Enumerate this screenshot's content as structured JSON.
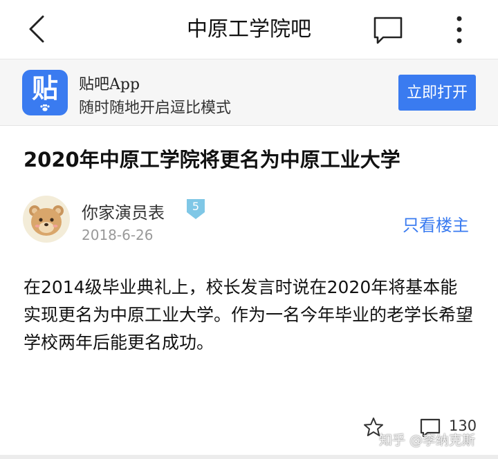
{
  "header": {
    "title": "中原工学院吧"
  },
  "promo": {
    "logo_char": "贴",
    "app_name": "贴吧App",
    "tagline": "随时随地开启逗比模式",
    "open_label": "立即打开",
    "accent_color": "#3a7bf0"
  },
  "post": {
    "title": "2020年中原工学院将更名为中原工业大学",
    "author": {
      "name": "你家演员表",
      "level": "5",
      "date": "2018-6-26"
    },
    "only_host_label": "只看楼主",
    "body": "在2014级毕业典礼上，校长发言时说在2020年将基本能实现更名为中原工业大学。作为一名今年毕业的老学长希望学校两年后能更名成功。",
    "reply_count": "130"
  },
  "watermark": "知乎 @李纳克斯"
}
